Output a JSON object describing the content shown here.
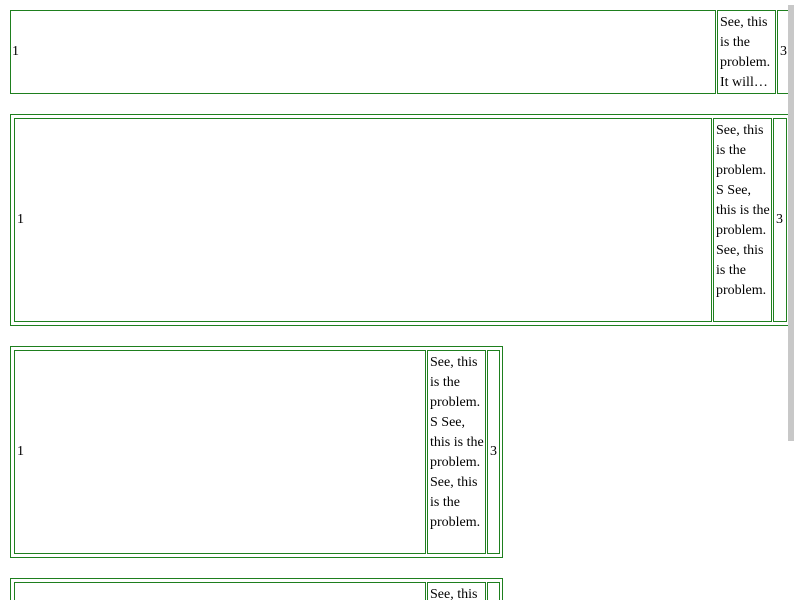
{
  "rows": [
    {
      "left_num": "1",
      "middle_text": "See, this is the problem. It will…",
      "right_num": "3"
    },
    {
      "left_num": "1",
      "middle_text": "See, this is the problem. S See, this is the problem. See, this is the problem.",
      "right_num": "3"
    },
    {
      "left_num": "1",
      "middle_text": "See, this is the problem. S See, this is the problem. See, this is the problem.",
      "right_num": "3"
    },
    {
      "middle_text": "See, this"
    }
  ]
}
